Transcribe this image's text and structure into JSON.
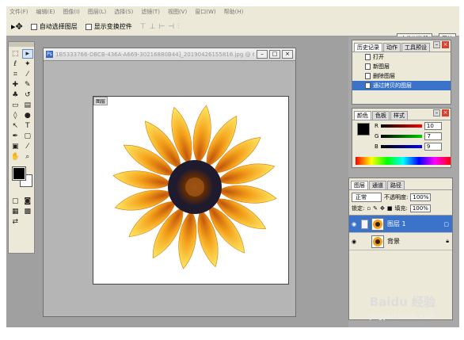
{
  "menubar": {
    "items": [
      "文件(F)",
      "编辑(E)",
      "图像(I)",
      "图层(L)",
      "选择(S)",
      "滤镜(T)",
      "视图(V)",
      "窗口(W)",
      "帮助(H)"
    ]
  },
  "options": {
    "tool_icon": "move-tool-icon",
    "auto_select": "自动选择图层",
    "show_bounds": "显示变换控件",
    "align_icons": [
      "⊤",
      "⊥",
      "⊢",
      "⊣",
      "⫶"
    ],
    "file_browser": "文件浏览器",
    "brushes": "画笔"
  },
  "document": {
    "title": "1B5333766-DBCB-436A-A669-30216880B44]_20190426155816.jpg @ 66.7% (图层...",
    "canvas_label": "图层"
  },
  "history": {
    "tabs": [
      "历史记录",
      "动作",
      "工具预设"
    ],
    "items": [
      "打开",
      "新图层",
      "删除图层",
      "通过拷贝的图层"
    ]
  },
  "color": {
    "tabs": [
      "颜色",
      "色板",
      "样式"
    ],
    "channels": [
      {
        "label": "R",
        "value": "10"
      },
      {
        "label": "G",
        "value": "7"
      },
      {
        "label": "B",
        "value": "9"
      }
    ]
  },
  "layers": {
    "tabs": [
      "图层",
      "通道",
      "路径"
    ],
    "mode": "正常",
    "opacity_label": "不透明度:",
    "opacity": "100%",
    "lock_label": "锁定:",
    "fill_label": "填充:",
    "fill": "100%",
    "items": [
      {
        "name": "图层 1",
        "selected": true
      },
      {
        "name": "背景",
        "selected": false
      }
    ]
  },
  "watermark": {
    "brand": "Baidu 经验",
    "url": "jingyan.baidu.com"
  }
}
